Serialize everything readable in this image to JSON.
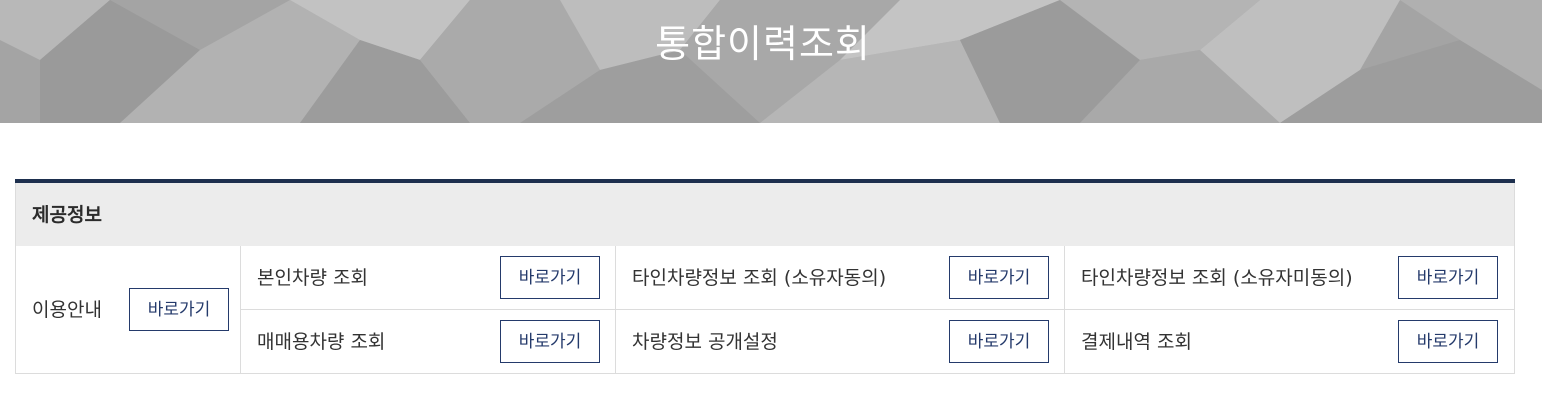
{
  "banner": {
    "title": "통합이력조회"
  },
  "panel": {
    "title": "제공정보",
    "usage": {
      "label": "이용안내",
      "button": "바로가기"
    },
    "rows": [
      [
        {
          "label": "본인차량 조회",
          "button": "바로가기"
        },
        {
          "label": "타인차량정보 조회 (소유자동의)",
          "button": "바로가기"
        },
        {
          "label": "타인차량정보 조회 (소유자미동의)",
          "button": "바로가기"
        }
      ],
      [
        {
          "label": "매매용차량 조회",
          "button": "바로가기"
        },
        {
          "label": "차량정보 공개설정",
          "button": "바로가기"
        },
        {
          "label": "결제내역 조회",
          "button": "바로가기"
        }
      ]
    ]
  },
  "colors": {
    "accent_navy": "#1d2f4e",
    "button_text": "#243a6b",
    "header_bg": "#ececec"
  }
}
